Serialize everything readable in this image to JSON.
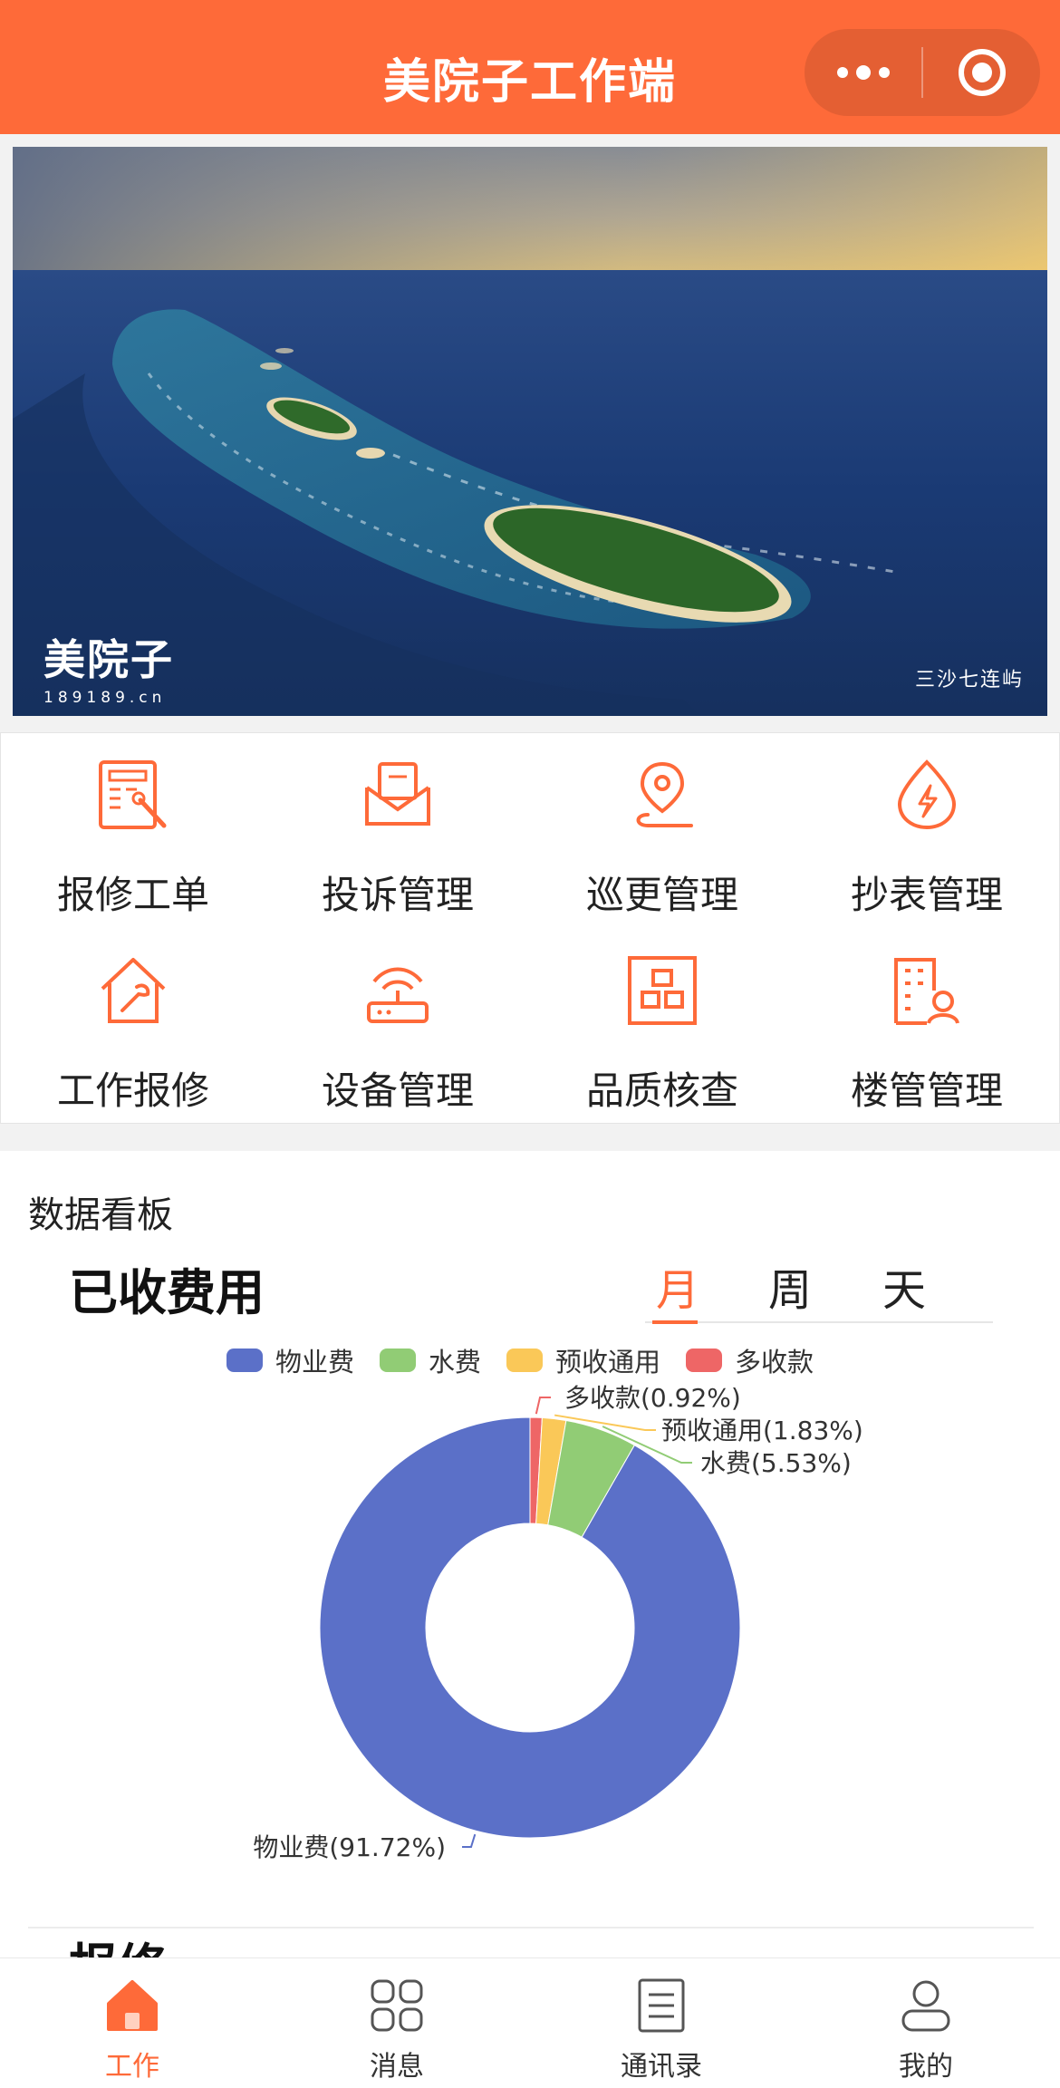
{
  "app": {
    "title": "美院子工作端"
  },
  "banner": {
    "brand_name": "美院子",
    "brand_url": "189189.cn",
    "caption": "三沙七连屿"
  },
  "menu": {
    "items": [
      {
        "label": "报修工单",
        "icon": "repair-order-icon"
      },
      {
        "label": "投诉管理",
        "icon": "complaint-mail-icon"
      },
      {
        "label": "巡更管理",
        "icon": "patrol-location-icon"
      },
      {
        "label": "抄表管理",
        "icon": "meter-reading-icon"
      },
      {
        "label": "工作报修",
        "icon": "house-wrench-icon"
      },
      {
        "label": "设备管理",
        "icon": "router-device-icon"
      },
      {
        "label": "品质核查",
        "icon": "quality-check-icon"
      },
      {
        "label": "楼管管理",
        "icon": "building-manager-icon"
      }
    ]
  },
  "dashboard": {
    "title": "数据看板",
    "card_title": "已收费用",
    "next_card_title": "报修",
    "tabs": [
      {
        "label": "月"
      },
      {
        "label": "周"
      },
      {
        "label": "天"
      }
    ],
    "active_tab": "月"
  },
  "chart_data": {
    "type": "pie",
    "title": "已收费用",
    "series": [
      {
        "name": "物业费",
        "value": 91.72,
        "label": "物业费(91.72%)",
        "color": "#5b70c8"
      },
      {
        "name": "水费",
        "value": 5.53,
        "label": "水费(5.53%)",
        "color": "#91cc75"
      },
      {
        "name": "预收通用",
        "value": 1.83,
        "label": "预收通用(1.83%)",
        "color": "#fac858"
      },
      {
        "name": "多收款",
        "value": 0.92,
        "label": "多收款(0.92%)",
        "color": "#ee6666"
      }
    ],
    "legend_position": "top-center"
  },
  "tabbar": {
    "items": [
      {
        "label": "工作",
        "icon": "home-icon"
      },
      {
        "label": "消息",
        "icon": "grid-icon"
      },
      {
        "label": "通讯录",
        "icon": "contacts-icon"
      },
      {
        "label": "我的",
        "icon": "user-icon"
      }
    ],
    "active": "工作"
  },
  "colors": {
    "accent": "#fe6a39"
  }
}
